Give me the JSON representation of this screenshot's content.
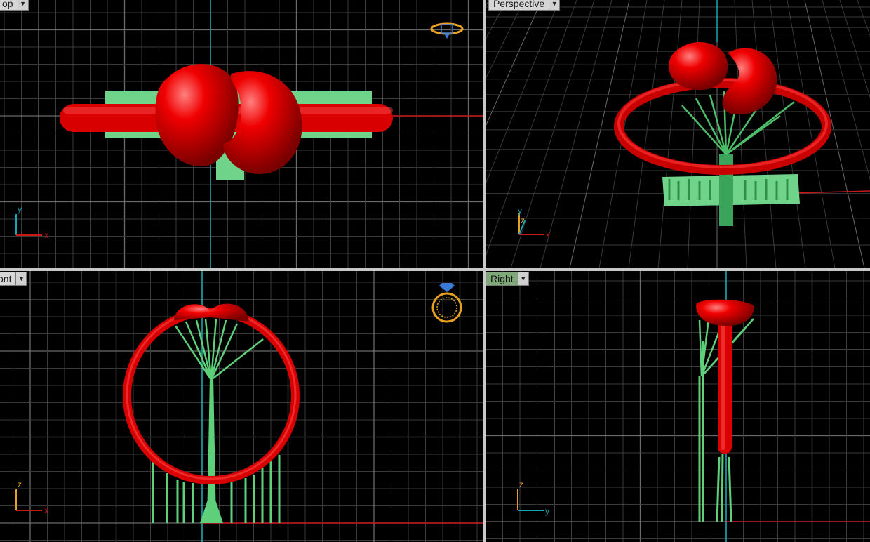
{
  "viewports": {
    "top": {
      "label": "op"
    },
    "perspective": {
      "label": "Perspective"
    },
    "front": {
      "label": "ont"
    },
    "right": {
      "label": "Right"
    }
  },
  "axis_labels": {
    "top": {
      "vertical": "y",
      "horizontal": "x"
    },
    "perspective": {
      "vertical": "y",
      "depth": "z",
      "horizontal": "x"
    },
    "front": {
      "vertical": "z",
      "horizontal": "x"
    },
    "right": {
      "vertical": "z",
      "horizontal": "y"
    }
  },
  "icons": {
    "dropdown": "chevron-down-icon",
    "top_widget": "ring-top-view-icon",
    "front_widget": "ring-front-view-icon"
  },
  "colors": {
    "background": "#000000",
    "grid_minor": "#3a3a3a",
    "grid_major": "#6a6a6a",
    "ring": "#e00000",
    "supports": "#5ed07a",
    "axis_x": "#c81818",
    "axis_y": "#16a6b6",
    "active_tab": "#7fa879",
    "widget": "#e8a020"
  }
}
